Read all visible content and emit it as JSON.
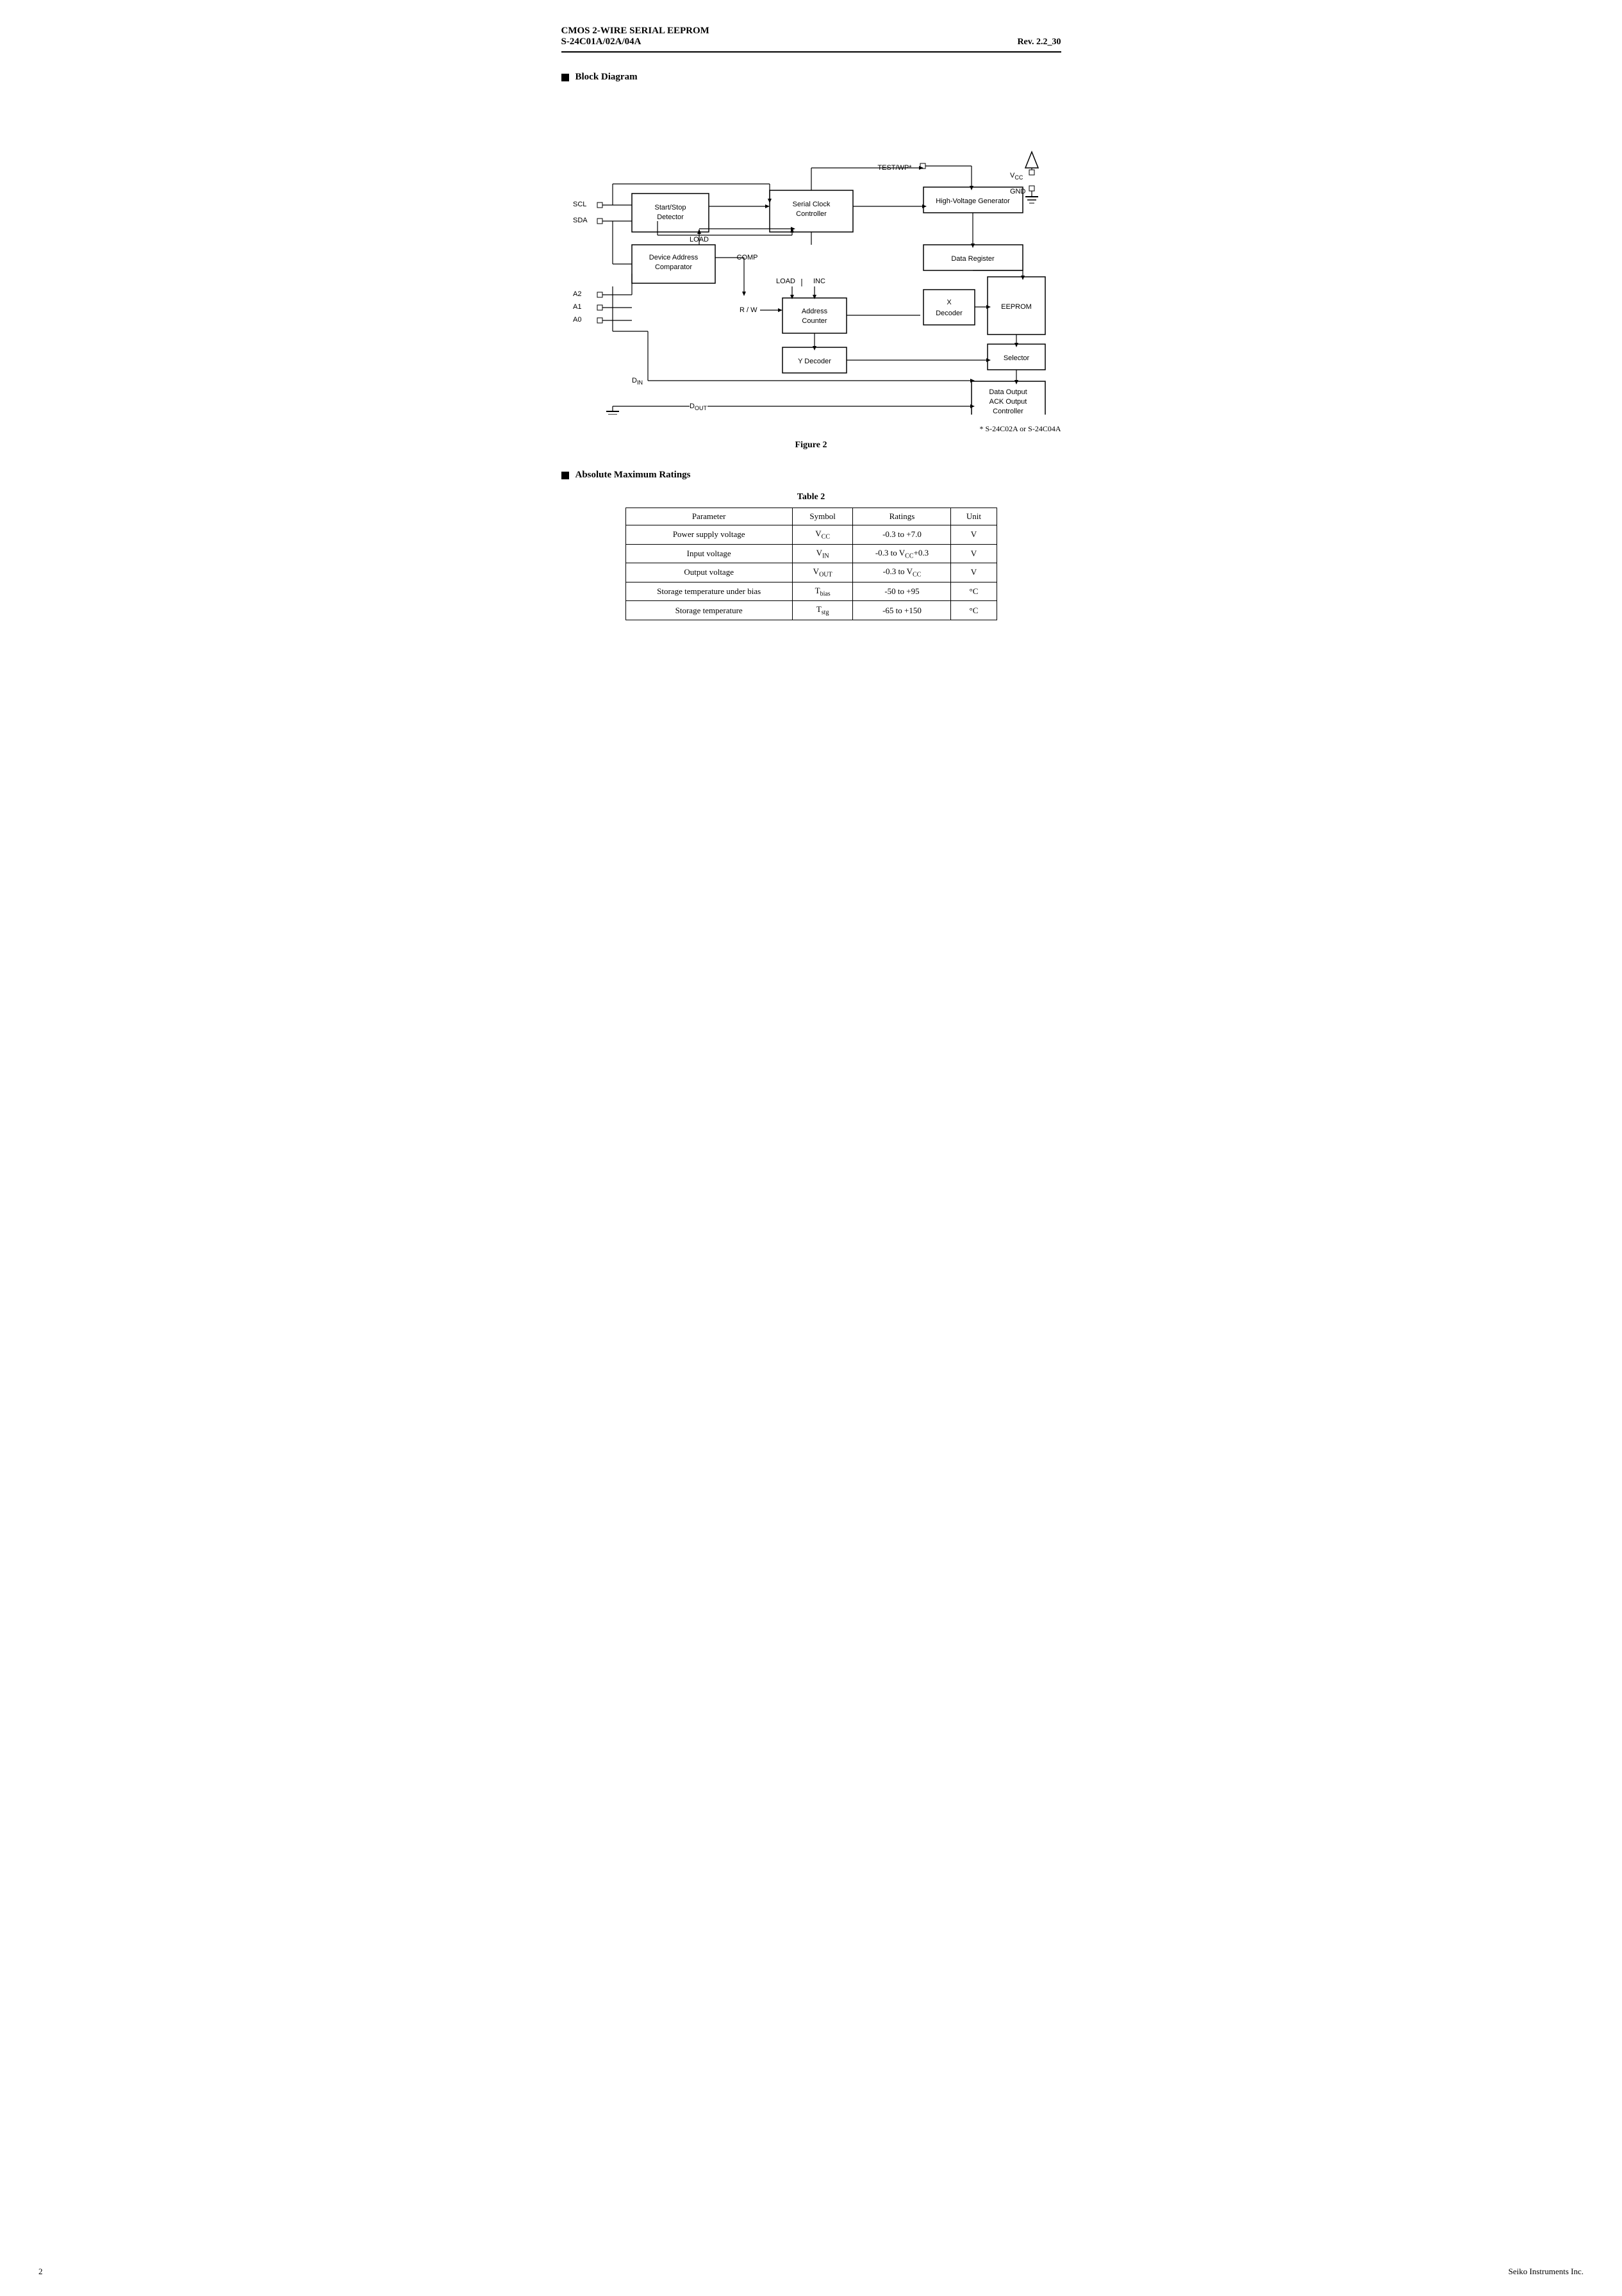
{
  "header": {
    "title_line1": "CMOS 2-WIRE SERIAL  EEPROM",
    "title_line2": "S-24C01A/02A/04A",
    "rev": "Rev. 2.2_30"
  },
  "sections": {
    "block_diagram": {
      "title": "Block Diagram",
      "figure_label": "Figure 2",
      "footnote": "*   S-24C02A or S-24C04A"
    },
    "ratings": {
      "title": "Absolute Maximum Ratings",
      "table_title": "Table  2",
      "columns": [
        "Parameter",
        "Symbol",
        "Ratings",
        "Unit"
      ],
      "rows": [
        [
          "Power supply voltage",
          "V_CC",
          "-0.3 to +7.0",
          "V"
        ],
        [
          "Input voltage",
          "V_IN",
          "-0.3 to V_CC+0.3",
          "V"
        ],
        [
          "Output voltage",
          "V_OUT",
          "-0.3 to V_CC",
          "V"
        ],
        [
          "Storage temperature under bias",
          "T_bias",
          "-50 to +95",
          "°C"
        ],
        [
          "Storage temperature",
          "T_stg",
          "-65 to +150",
          "°C"
        ]
      ]
    }
  },
  "footer": {
    "page_number": "2",
    "company": "Seiko Instruments Inc."
  }
}
